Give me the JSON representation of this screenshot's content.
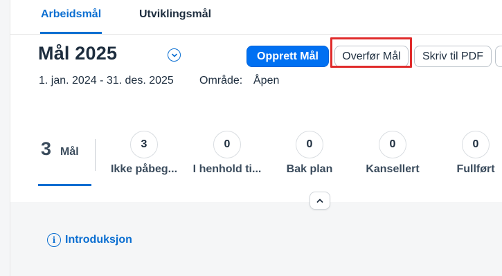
{
  "tabs": [
    {
      "label": "Arbeidsmål",
      "active": true
    },
    {
      "label": "Utviklingsmål",
      "active": false
    }
  ],
  "header": {
    "title": "Mål 2025",
    "date_range": "1. jan. 2024 - 31. des. 2025",
    "area_label": "Område:",
    "area_value": "Åpen"
  },
  "actions": {
    "create_label": "Opprett Mål",
    "transfer_label": "Overfør Mål",
    "pdf_label": "Skriv til PDF"
  },
  "summary": {
    "count": "3",
    "count_label": "Mål"
  },
  "statuses": [
    {
      "count": "3",
      "label": "Ikke påbeg..."
    },
    {
      "count": "0",
      "label": "I henhold ti..."
    },
    {
      "count": "0",
      "label": "Bak plan"
    },
    {
      "count": "0",
      "label": "Kansellert"
    },
    {
      "count": "0",
      "label": "Fullført"
    }
  ],
  "intro": {
    "label": "Introduksjon"
  },
  "colors": {
    "accent": "#0a6ed1",
    "primary_button": "#0070f2",
    "highlight": "#e02b2b"
  },
  "icons": {
    "title_toggle": "chevron-down-icon",
    "collapse": "chevron-up-icon",
    "intro": "info-icon"
  }
}
